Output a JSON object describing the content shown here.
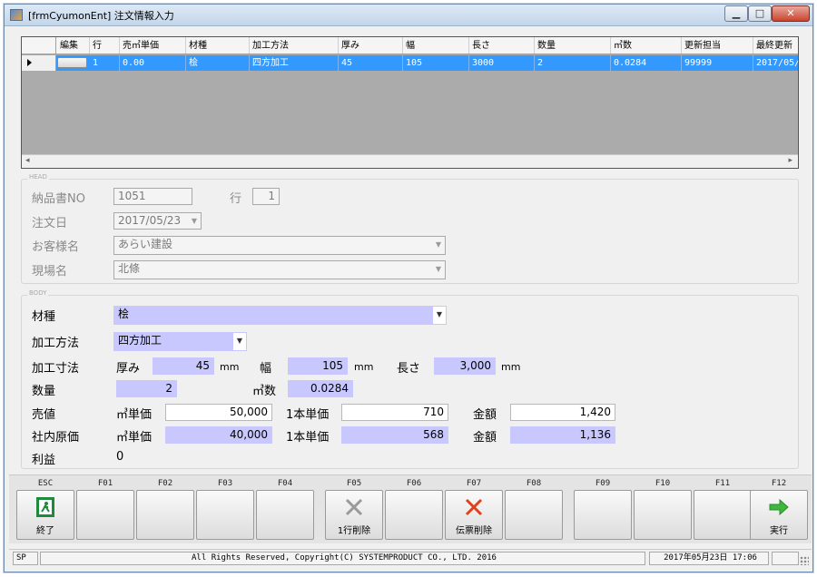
{
  "window": {
    "title": "[frmCyumonEnt] 注文情報入力",
    "min_glyph": "▁",
    "max_glyph": "□",
    "close_glyph": "✕"
  },
  "grid": {
    "columns": [
      "編集",
      "行",
      "売㎥単価",
      "材種",
      "加工方法",
      "厚み",
      "幅",
      "長さ",
      "数量",
      "㎥数",
      "更新担当",
      "最終更新"
    ],
    "rows": [
      {
        "edit": "",
        "row": "1",
        "unit_price": "0.00",
        "material": "桧",
        "process": "四方加工",
        "thickness": "45",
        "width": "105",
        "length": "3000",
        "qty": "2",
        "volume": "0.0284",
        "updater": "99999",
        "last_update": "2017/05/2"
      }
    ],
    "scroll_left": "◂",
    "scroll_right": "▸"
  },
  "head": {
    "legend": "HEAD",
    "delivery_no_label": "納品書NO",
    "delivery_no": "1051",
    "line_label": "行",
    "line_value": "1",
    "order_date_label": "注文日",
    "order_date": "2017/05/23",
    "customer_label": "お客様名",
    "customer": "あらい建設",
    "site_label": "現場名",
    "site": "北條"
  },
  "body": {
    "legend": "BODY",
    "material_label": "材種",
    "material": "桧",
    "process_label": "加工方法",
    "process": "四方加工",
    "dimension_label": "加工寸法",
    "thickness_label": "厚み",
    "thickness": "45",
    "width_label": "幅",
    "width": "105",
    "length_label": "長さ",
    "length": "3,000",
    "unit_mm": "mm",
    "qty_label": "数量",
    "qty": "2",
    "volume_label": "㎥数",
    "volume": "0.0284",
    "sell_label": "売値",
    "cost_label": "社内原価",
    "m3_price_label": "㎥単価",
    "piece_price_label": "1本単価",
    "amount_label": "金額",
    "sell_m3_price": "50,000",
    "sell_piece_price": "710",
    "sell_amount": "1,420",
    "cost_m3_price": "40,000",
    "cost_piece_price": "568",
    "cost_amount": "1,136",
    "profit_label": "利益",
    "profit": "0"
  },
  "fkeys": [
    {
      "key": "ESC",
      "caption": "終了",
      "icon": "exit-icon"
    },
    {
      "key": "F01",
      "caption": "",
      "icon": ""
    },
    {
      "key": "F02",
      "caption": "",
      "icon": ""
    },
    {
      "key": "F03",
      "caption": "",
      "icon": ""
    },
    {
      "key": "F04",
      "caption": "",
      "icon": ""
    },
    {
      "key": "F05",
      "caption": "1行削除",
      "icon": "delete-row-icon"
    },
    {
      "key": "F06",
      "caption": "",
      "icon": ""
    },
    {
      "key": "F07",
      "caption": "伝票削除",
      "icon": "delete-slip-icon"
    },
    {
      "key": "F08",
      "caption": "",
      "icon": ""
    },
    {
      "key": "F09",
      "caption": "",
      "icon": ""
    },
    {
      "key": "F10",
      "caption": "",
      "icon": ""
    },
    {
      "key": "F11",
      "caption": "",
      "icon": ""
    },
    {
      "key": "F12",
      "caption": "実行",
      "icon": "execute-arrow-icon"
    }
  ],
  "status": {
    "mode": "SP",
    "copyright": "All Rights Reserved, Copyright(C) SYSTEMPRODUCT CO., LTD. 2016",
    "datetime": "2017年05月23日 17:06"
  },
  "colors": {
    "selection": "#3399ff",
    "input_highlight": "#c8c8ff",
    "exit_green": "#1e8a3a",
    "delete_red": "#e0401a",
    "execute_green": "#3cb83c"
  }
}
